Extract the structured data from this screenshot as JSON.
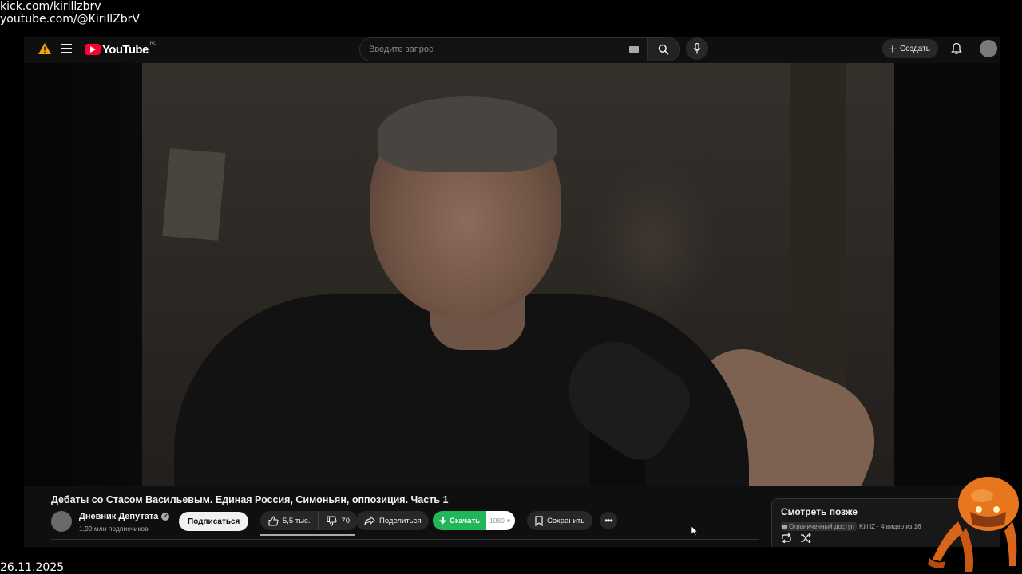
{
  "overlay": {
    "line1": "kick.com/kirillzbrv",
    "line2": "youtube.com/@KirillZbrV",
    "date": "26.11.2025"
  },
  "masthead": {
    "logo_text": "YouTube",
    "country_code": "RU",
    "search_placeholder": "Введите запрос",
    "create_label": "Создать"
  },
  "video": {
    "title": "Дебаты со Стасом Васильевым. Единая Россия, Симоньян, оппозиция. Часть 1",
    "channel_name": "Дневник Депутата",
    "subscribers": "1,99 млн подписчиков",
    "subscribe_label": "Подписаться",
    "likes": "5,5 тыс.",
    "dislikes": "70",
    "share_label": "Поделиться",
    "download_label": "Скачать",
    "download_quality": "1080",
    "save_label": "Сохранить"
  },
  "watch_later": {
    "title": "Смотреть позже",
    "access_badge": "Ограниченный доступ",
    "owner_info": "KirillZ · 4 видео из 16"
  },
  "colors": {
    "youtube_red": "#ff0033",
    "download_green": "#21b65a",
    "background": "#0f0f0f"
  }
}
